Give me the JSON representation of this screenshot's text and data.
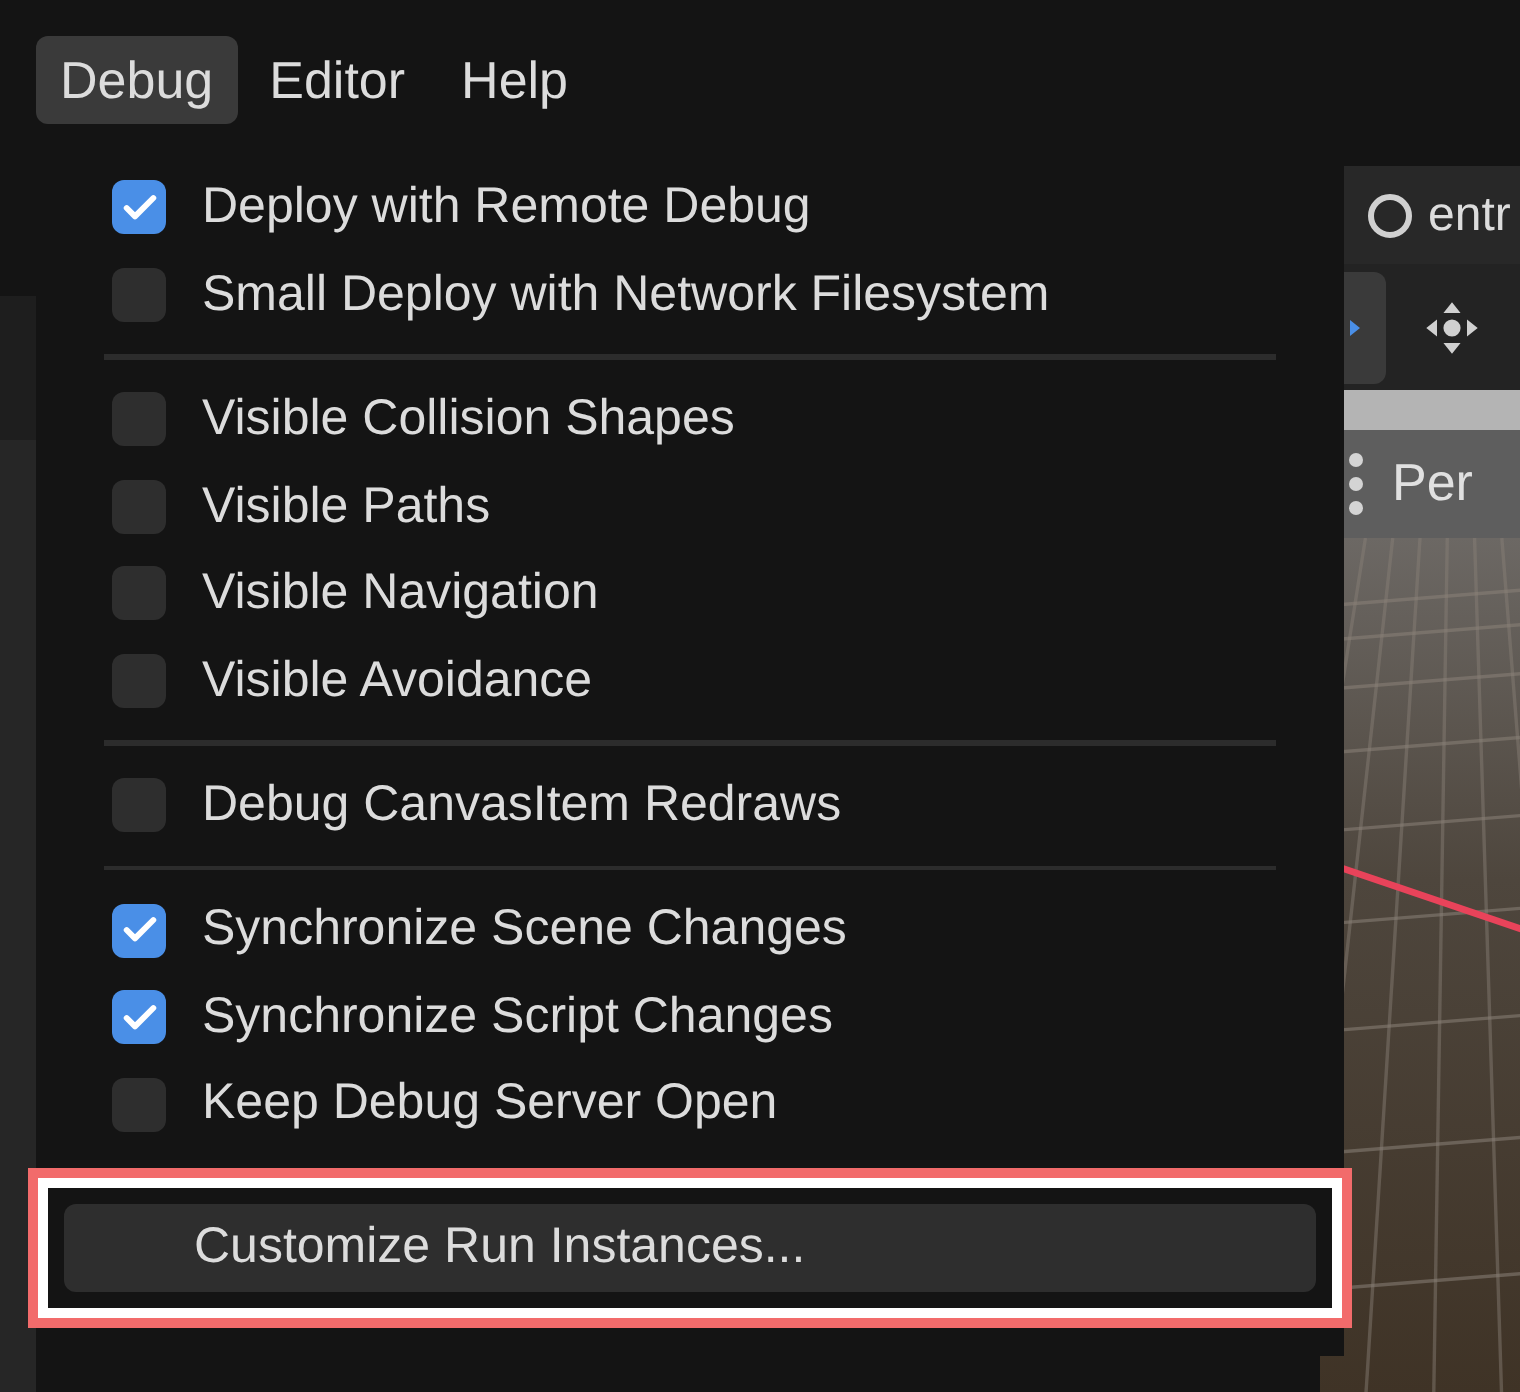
{
  "menubar": [
    {
      "label": "Debug",
      "selected": true
    },
    {
      "label": "Editor",
      "selected": false
    },
    {
      "label": "Help",
      "selected": false
    }
  ],
  "scene_tab": {
    "label": "entr"
  },
  "viewport": {
    "label": "Per"
  },
  "menu": [
    {
      "kind": "check",
      "label": "Deploy with Remote Debug",
      "checked": true
    },
    {
      "kind": "check",
      "label": "Small Deploy with Network Filesystem",
      "checked": false
    },
    {
      "kind": "separator"
    },
    {
      "kind": "check",
      "label": "Visible Collision Shapes",
      "checked": false
    },
    {
      "kind": "check",
      "label": "Visible Paths",
      "checked": false
    },
    {
      "kind": "check",
      "label": "Visible Navigation",
      "checked": false
    },
    {
      "kind": "check",
      "label": "Visible Avoidance",
      "checked": false
    },
    {
      "kind": "separator"
    },
    {
      "kind": "check",
      "label": "Debug CanvasItem Redraws",
      "checked": false
    },
    {
      "kind": "separator"
    },
    {
      "kind": "check",
      "label": "Synchronize Scene Changes",
      "checked": true
    },
    {
      "kind": "check",
      "label": "Synchronize Script Changes",
      "checked": true
    },
    {
      "kind": "check",
      "label": "Keep Debug Server Open",
      "checked": false
    },
    {
      "kind": "action",
      "label": "Customize Run Instances...",
      "hovered": true,
      "outlined": true
    }
  ]
}
